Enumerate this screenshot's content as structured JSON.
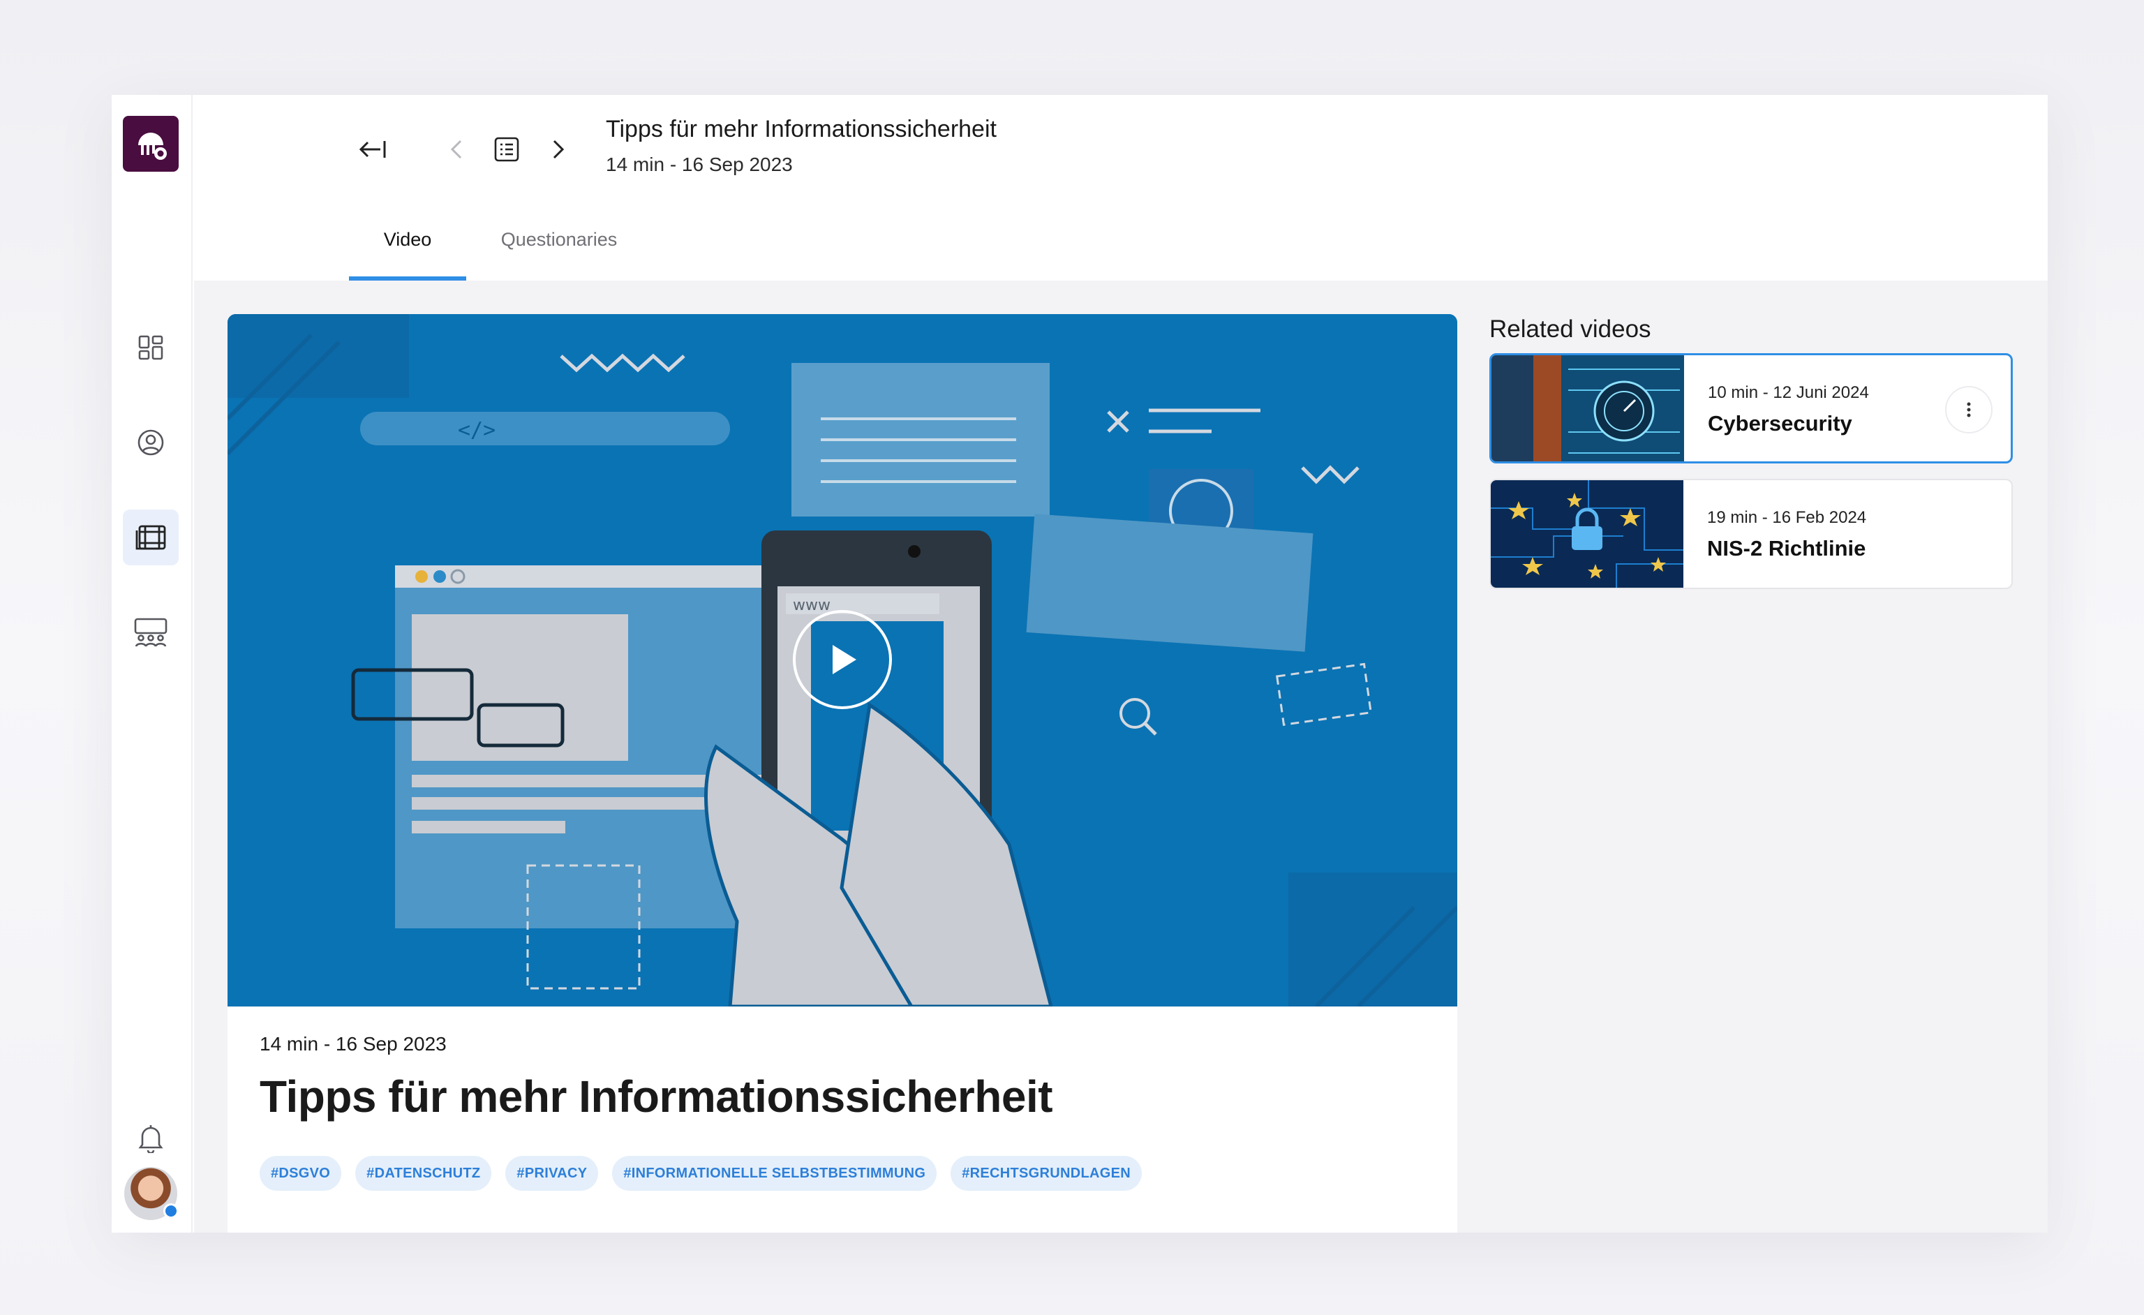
{
  "header": {
    "title": "Tipps für mehr Informationssicherheit",
    "subtitle": "14 min - 16 Sep 2023"
  },
  "tabs": [
    {
      "label": "Video",
      "active": true
    },
    {
      "label": "Questionaries",
      "active": false
    }
  ],
  "sidebar": {
    "items": [
      {
        "icon": "dashboard-icon"
      },
      {
        "icon": "user-circle-icon"
      },
      {
        "icon": "film-icon",
        "active": true
      },
      {
        "icon": "group-icon"
      }
    ],
    "bottom": [
      {
        "icon": "bell-icon"
      },
      {
        "icon": "avatar"
      }
    ]
  },
  "video": {
    "meta": "14 min - 16 Sep 2023",
    "title": "Tipps für mehr Informationssicherheit",
    "tags": [
      "#DSGVO",
      "#DATENSCHUTZ",
      "#PRIVACY",
      "#INFORMATIONELLE SELBSTBESTIMMUNG",
      "#RECHTSGRUNDLAGEN"
    ],
    "url_bar": "www"
  },
  "related": {
    "heading": "Related videos",
    "items": [
      {
        "meta": "10 min - 12 Juni 2024",
        "title": "Cybersecurity",
        "selected": true
      },
      {
        "meta": "19 min - 16 Feb 2024",
        "title": "NIS-2 Richtlinie",
        "selected": false
      }
    ]
  },
  "colors": {
    "accent": "#2f8ee5",
    "brand": "#4a0d3f",
    "video_bg": "#0a73b4",
    "tag_bg": "#e4effb"
  }
}
